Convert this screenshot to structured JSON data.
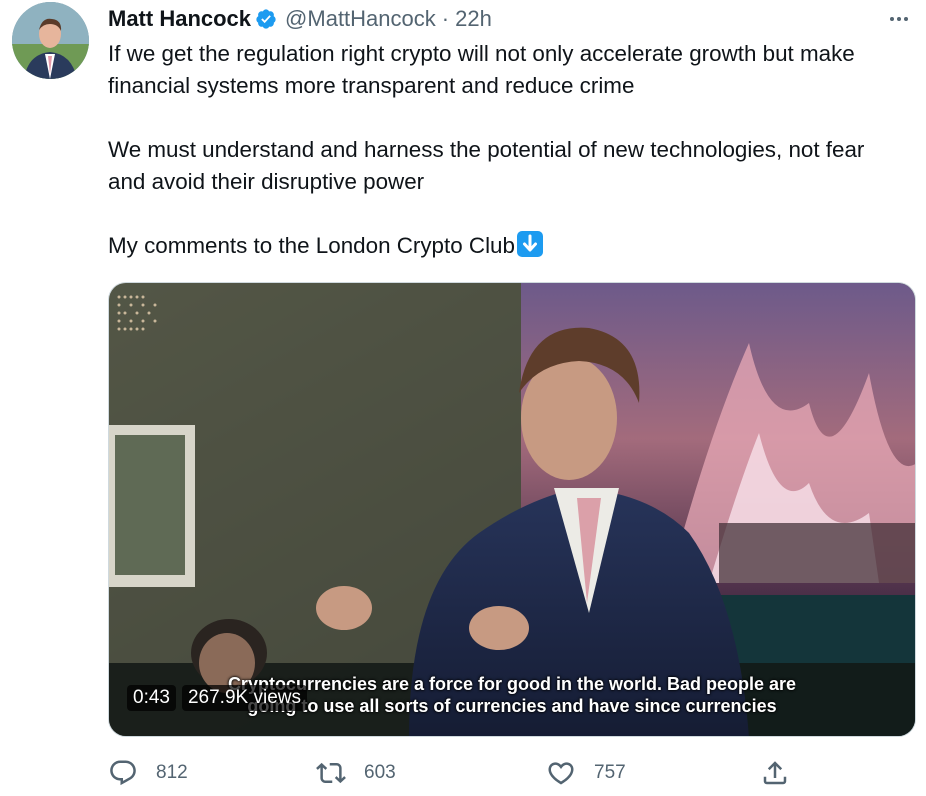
{
  "tweet": {
    "author_name": "Matt Hancock",
    "handle": "@MattHancock",
    "separator": "·",
    "time": "22h",
    "more_icon": "more-horizontal-icon",
    "verified_icon": "verified-badge-icon",
    "paragraphs": [
      "If we get the regulation right crypto will not only accelerate growth but make financial systems more transparent and reduce crime",
      "We must understand and harness the potential of new technologies, not fear and avoid their disruptive power",
      "My comments to the London Crypto Club"
    ],
    "emoji": "down-arrow-emoji",
    "accent_color": "#1d9bf0"
  },
  "media": {
    "caption_line1": "Cryptocurrencies are a force for good in the world. Bad people are",
    "caption_line2": "going to use all sorts of currencies and have since currencies",
    "duration": "0:43",
    "views": "267.9K views"
  },
  "actions": {
    "reply_count": "812",
    "retweet_count": "603",
    "like_count": "757",
    "reply_icon": "reply-icon",
    "retweet_icon": "retweet-icon",
    "like_icon": "heart-icon",
    "share_icon": "share-icon"
  }
}
